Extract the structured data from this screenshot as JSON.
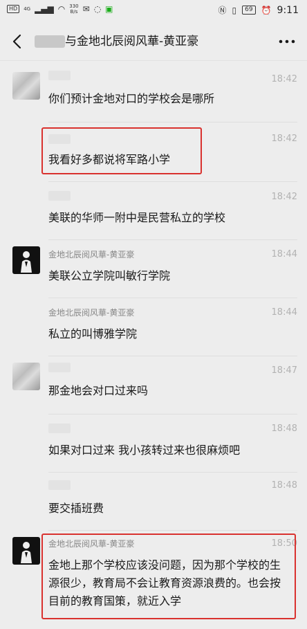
{
  "status": {
    "left_badge": "HD",
    "network": "4G",
    "speed_value": "330",
    "speed_unit": "B/s",
    "battery": "69",
    "time": "9:11"
  },
  "header": {
    "title": "与金地北辰阅风華-黄亚豪"
  },
  "messages": [
    {
      "time": "18:42",
      "text": "你们预计金地对口的学校会是哪所"
    },
    {
      "time": "18:42",
      "text": "我看好多都说将军路小学"
    },
    {
      "time": "18:42",
      "text": "美联的华师一附中是民营私立的学校"
    },
    {
      "name": "金地北辰阅风華-黄亚豪",
      "time": "18:44",
      "text": "美联公立学院叫敏行学院"
    },
    {
      "name": "金地北辰阅风華-黄亚豪",
      "time": "18:44",
      "text": "私立的叫博雅学院"
    },
    {
      "time": "18:47",
      "text": "那金地会对口过来吗"
    },
    {
      "time": "18:48",
      "text": "如果对口过来 我小孩转过来也很麻烦吧"
    },
    {
      "time": "18:48",
      "text": "要交插班费"
    },
    {
      "name": "金地北辰阅风華-黄亚豪",
      "time": "18:50",
      "text": "金地上那个学校应该没问题，因为那个学校的生源很少，教育局不会让教育资源浪费的。也会按目前的教育国策，就近入学"
    }
  ]
}
